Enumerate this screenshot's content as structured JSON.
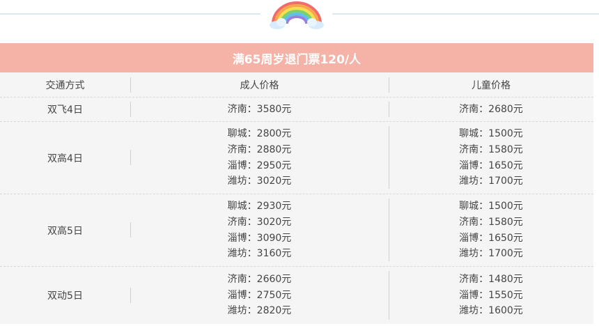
{
  "banner": {
    "title": "满65周岁退门票120/人"
  },
  "header": {
    "col1": "交通方式",
    "col2": "成人价格",
    "col3": "儿童价格"
  },
  "rows": [
    {
      "mode": "双飞4日",
      "adult": [
        "济南：3580元"
      ],
      "child": [
        "济南：2680元"
      ]
    },
    {
      "mode": "双高4日",
      "adult": [
        "聊城：2800元",
        "济南：2880元",
        "淄博：2950元",
        "潍坊：3020元"
      ],
      "child": [
        "聊城：1500元",
        "济南：1580元",
        "淄博：1650元",
        "潍坊：1700元"
      ]
    },
    {
      "mode": "双高5日",
      "adult": [
        "聊城：2930元",
        "济南：3020元",
        "淄博：3090元",
        "潍坊：3160元"
      ],
      "child": [
        "聊城：1500元",
        "济南：1580元",
        "淄博：1650元",
        "潍坊：1700元"
      ]
    },
    {
      "mode": "双动5日",
      "adult": [
        "济南：2660元",
        "淄博：2750元",
        "潍坊：2820元"
      ],
      "child": [
        "济南：1480元",
        "淄博：1550元",
        "潍坊：1600元"
      ]
    }
  ],
  "decor": {
    "rainbow_icon": "rainbow-with-clouds",
    "banner_color": "#f5b2a7",
    "divider_color": "#dbe7f3"
  }
}
